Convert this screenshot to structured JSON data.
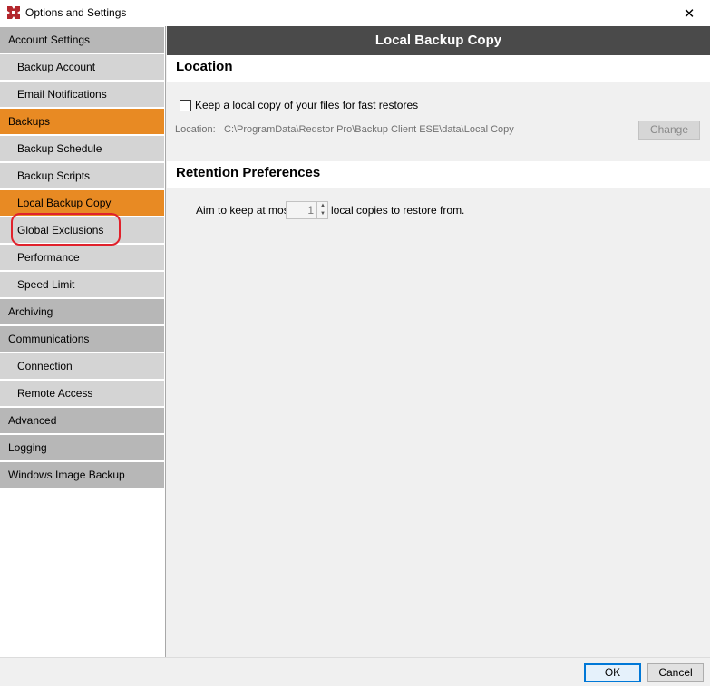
{
  "window": {
    "title": "Options and Settings",
    "app_icon": "redstor-logo-icon",
    "close_glyph": "✕"
  },
  "sidebar": {
    "items": [
      {
        "label": "Account Settings",
        "level": "section",
        "active": false
      },
      {
        "label": "Backup Account",
        "level": "child",
        "active": false
      },
      {
        "label": "Email Notifications",
        "level": "child",
        "active": false
      },
      {
        "label": "Backups",
        "level": "section",
        "active": true
      },
      {
        "label": "Backup Schedule",
        "level": "child",
        "active": false
      },
      {
        "label": "Backup Scripts",
        "level": "child",
        "active": false
      },
      {
        "label": "Local Backup Copy",
        "level": "child",
        "active": true
      },
      {
        "label": "Global Exclusions",
        "level": "child",
        "active": false
      },
      {
        "label": "Performance",
        "level": "child",
        "active": false
      },
      {
        "label": "Speed Limit",
        "level": "child",
        "active": false
      },
      {
        "label": "Archiving",
        "level": "section",
        "active": false
      },
      {
        "label": "Communications",
        "level": "section",
        "active": false
      },
      {
        "label": "Connection",
        "level": "child",
        "active": false
      },
      {
        "label": "Remote Access",
        "level": "child",
        "active": false
      },
      {
        "label": "Advanced",
        "level": "section",
        "active": false
      },
      {
        "label": "Logging",
        "level": "section",
        "active": false
      },
      {
        "label": "Windows Image Backup",
        "level": "section",
        "active": false
      }
    ]
  },
  "content": {
    "header": "Local Backup Copy",
    "location_section": {
      "title": "Location",
      "checkbox_label": "Keep a local copy of your files for fast restores",
      "checkbox_checked": false,
      "location_label": "Location:",
      "location_value": "C:\\ProgramData\\Redstor Pro\\Backup Client ESE\\data\\Local Copy",
      "change_label": "Change"
    },
    "retention_section": {
      "title": "Retention Preferences",
      "aim_label": "Aim to keep at most",
      "copies_value": "1",
      "copies_label": "local copies to restore from."
    }
  },
  "footer": {
    "ok_label": "OK",
    "cancel_label": "Cancel"
  },
  "colors": {
    "accent_orange": "#e88a23",
    "header_dark": "#4a4a4a",
    "section_gray": "#b7b7b7",
    "child_gray": "#d4d4d4",
    "annotation_red": "#e0212b",
    "logo_red": "#b3262c"
  }
}
